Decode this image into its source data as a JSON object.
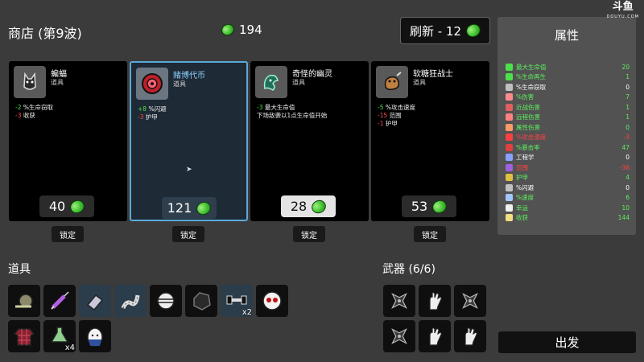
{
  "header": {
    "title": "商店 (第9波)",
    "materials": "194",
    "reroll_label": "刷新 - 12"
  },
  "cards": [
    {
      "name": "蝙蝠",
      "category": "道具",
      "stats": [
        {
          "num": "-2",
          "text": " %生命窃取",
          "sign": "pos"
        },
        {
          "num": "-3",
          "text": " 收获",
          "sign": "neg"
        }
      ],
      "price": "40",
      "icon": "bat-icon"
    },
    {
      "name": "赌博代币",
      "category": "道具",
      "stats": [
        {
          "num": "+8",
          "text": " %闪避",
          "sign": "pos"
        },
        {
          "num": "-3",
          "text": " 护甲",
          "sign": "neg"
        }
      ],
      "price": "121",
      "icon": "gambling-token-icon"
    },
    {
      "name": "奇怪的幽灵",
      "category": "道具",
      "stats": [
        {
          "num": "-3",
          "text": " 最大生命值",
          "sign": "pos"
        },
        {
          "num": "",
          "text": "下场敌袭以1点生命值开始",
          "sign": "none"
        }
      ],
      "price": "28",
      "icon": "strange-ghost-icon"
    },
    {
      "name": "软糖狂战士",
      "category": "道具",
      "stats": [
        {
          "num": "-5",
          "text": " %攻击速度",
          "sign": "pos"
        },
        {
          "num": "-15",
          "text": " 范围",
          "sign": "neg"
        },
        {
          "num": "-1",
          "text": " 护甲",
          "sign": "neg"
        }
      ],
      "price": "53",
      "icon": "jelly-berserker-icon"
    }
  ],
  "lock_label": "锁定",
  "items_title": "道具",
  "items": [
    {
      "icon": "snail-icon",
      "qty": ""
    },
    {
      "icon": "syringe-icon",
      "qty": ""
    },
    {
      "icon": "eraser-icon",
      "qty": ""
    },
    {
      "icon": "worm-icon",
      "qty": ""
    },
    {
      "icon": "bandaged-head-icon",
      "qty": ""
    },
    {
      "icon": "black-rock-icon",
      "qty": ""
    },
    {
      "icon": "dumbbell-icon",
      "qty": "x2"
    },
    {
      "icon": "alien-eyes-icon",
      "qty": ""
    },
    {
      "icon": "plaid-shirt-icon",
      "qty": ""
    },
    {
      "icon": "green-potion-icon",
      "qty": "x4"
    },
    {
      "icon": "egg-icon",
      "qty": ""
    }
  ],
  "weapons_title": "武器 (6/6)",
  "weapons": [
    "shuriken-icon",
    "hand-icon",
    "shuriken-icon",
    "shuriken-icon",
    "hand-icon",
    "hand-icon"
  ],
  "stats_title": "属性",
  "stats": [
    {
      "label": "最大生命值",
      "value": "20",
      "color": "green",
      "icon_color": "#4de04d"
    },
    {
      "label": "%生命再生",
      "value": "1",
      "color": "green",
      "icon_color": "#4de04d"
    },
    {
      "label": "%生命窃取",
      "value": "0",
      "color": "white",
      "icon_color": "#c0c0c0"
    },
    {
      "label": "%伤害",
      "value": "7",
      "color": "green",
      "icon_color": "#ff8c8c"
    },
    {
      "label": "近战伤害",
      "value": "1",
      "color": "green",
      "icon_color": "#e06060"
    },
    {
      "label": "远程伤害",
      "value": "1",
      "color": "green",
      "icon_color": "#ff8080"
    },
    {
      "label": "属性伤害",
      "value": "0",
      "color": "green",
      "icon_color": "#ff9966"
    },
    {
      "label": "%攻击速度",
      "value": "-3",
      "color": "red",
      "icon_color": "#ff4040"
    },
    {
      "label": "%暴击率",
      "value": "47",
      "color": "green",
      "icon_color": "#e04040"
    },
    {
      "label": "工程学",
      "value": "0",
      "color": "white",
      "icon_color": "#8aa0ff"
    },
    {
      "label": "范围",
      "value": "-36",
      "color": "red",
      "icon_color": "#a060e0"
    },
    {
      "label": "护甲",
      "value": "4",
      "color": "green",
      "icon_color": "#e0c040"
    },
    {
      "label": "%闪避",
      "value": "0",
      "color": "white",
      "icon_color": "#c0c0c0"
    },
    {
      "label": "%速度",
      "value": "6",
      "color": "green",
      "icon_color": "#a0c8ff"
    },
    {
      "label": "幸运",
      "value": "10",
      "color": "green",
      "icon_color": "#f0f0f0"
    },
    {
      "label": "收获",
      "value": "144",
      "color": "green",
      "icon_color": "#f0e080"
    }
  ],
  "go_label": "出发",
  "watermark": {
    "main": "斗鱼",
    "sub": "DOUYU.COM"
  }
}
